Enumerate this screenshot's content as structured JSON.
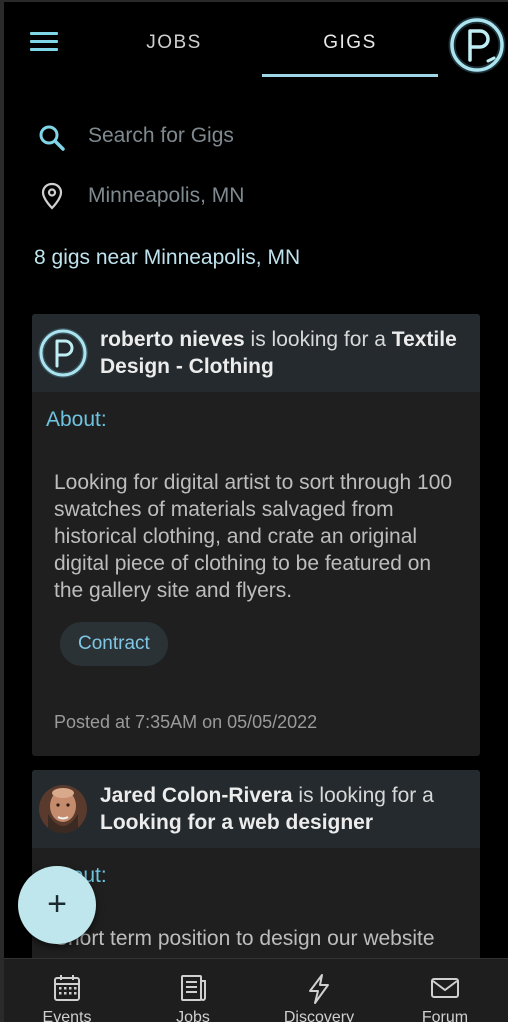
{
  "header": {
    "tabs": [
      {
        "label": "JOBS",
        "active": false
      },
      {
        "label": "GIGS",
        "active": true
      }
    ]
  },
  "search": {
    "placeholder": "Search for Gigs",
    "value": ""
  },
  "location": {
    "placeholder": "Minneapolis, MN",
    "value": ""
  },
  "results_count": "8 gigs near Minneapolis, MN",
  "gigs": [
    {
      "poster": "roberto nieves",
      "connector": " is looking for a ",
      "title": "Textile Design - Clothing",
      "about_label": "About:",
      "description": "Looking for digital artist to sort through 100 swatches of materials salvaged from historical clothing, and crate an original digital piece of clothing to be featured on the gallery site and flyers.",
      "type": "Contract",
      "posted": "Posted at 7:35AM on 05/05/2022"
    },
    {
      "poster": "Jared Colon-Rivera",
      "connector": " is looking for a ",
      "title": "Looking for a web designer",
      "about_label": "About:",
      "description": "Short term position to design our website"
    }
  ],
  "fab": {
    "symbol": "+"
  },
  "nav": {
    "items": [
      {
        "label": "Events",
        "icon": "calendar-icon"
      },
      {
        "label": "Jobs",
        "icon": "document-icon"
      },
      {
        "label": "Discovery",
        "icon": "lightning-icon"
      },
      {
        "label": "Forum",
        "icon": "mail-icon"
      }
    ]
  },
  "colors": {
    "accent": "#6ec3e0",
    "fab": "#bfe6ec",
    "card": "#1f1f1f",
    "card_header": "#242a2d"
  }
}
